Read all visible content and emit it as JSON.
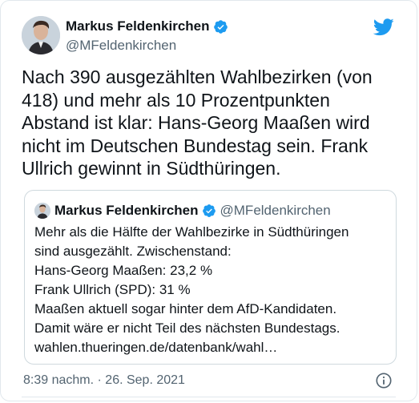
{
  "author": {
    "name": "Markus Feldenkirchen",
    "handle": "@MFeldenkirchen",
    "verified": true
  },
  "tweet": {
    "lines": [
      "Nach 390 ausgezählten Wahlbezirken (von",
      "418) und mehr als 10 Prozentpunkten",
      "Abstand ist klar: Hans-Georg Maaßen wird",
      "nicht im Deutschen Bundestag sein. Frank",
      "Ullrich gewinnt in Südthüringen."
    ]
  },
  "quoted_tweet": {
    "name": "Markus Feldenkirchen",
    "handle": "@MFeldenkirchen",
    "lines": [
      "Mehr als die Hälfte der Wahlbezirke in Südthüringen",
      "sind ausgezählt. Zwischenstand:",
      "Hans-Georg Maaßen: 23,2 %",
      "Frank Ullrich (SPD): 31 %",
      "Maaßen aktuell sogar hinter dem AfD-Kandidaten.",
      "Damit wäre er nicht Teil des nächsten Bundestags.",
      "wahlen.thueringen.de/datenbank/wahl…"
    ]
  },
  "meta": {
    "time": "8:39 nachm.",
    "separator": "·",
    "date": "26. Sep. 2021"
  },
  "icons": {
    "verified": "verified-badge-icon",
    "logo": "twitter-bird-icon",
    "info": "info-icon"
  },
  "colors": {
    "twitter_blue": "#1d9bf0",
    "text": "#0f1419",
    "secondary": "#536471",
    "border": "#cfd9de"
  }
}
